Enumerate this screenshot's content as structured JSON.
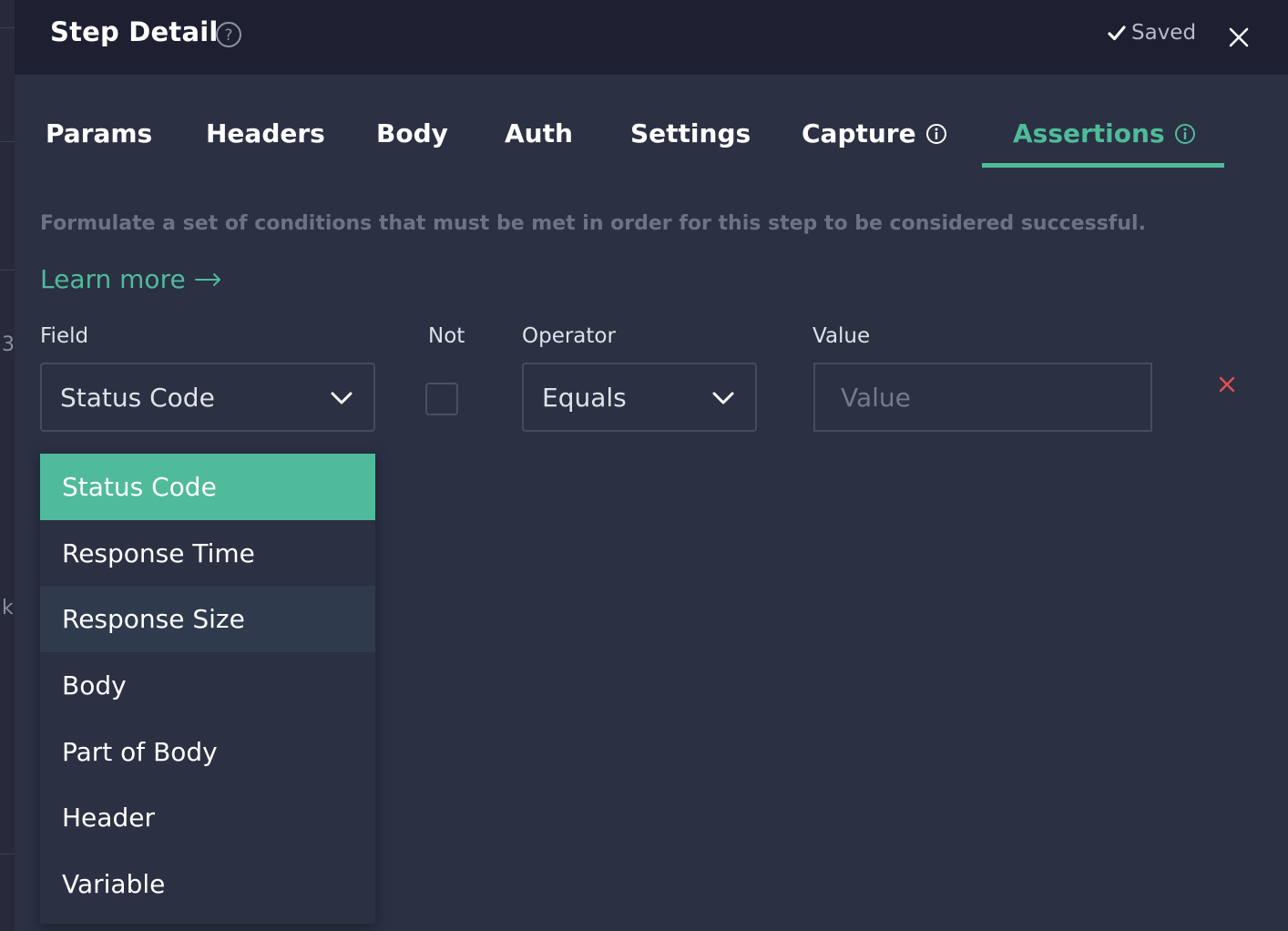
{
  "header": {
    "title": "Step Detail",
    "saved_label": "Saved"
  },
  "tabs": [
    {
      "label": "Params"
    },
    {
      "label": "Headers"
    },
    {
      "label": "Body"
    },
    {
      "label": "Auth"
    },
    {
      "label": "Settings"
    },
    {
      "label": "Capture"
    },
    {
      "label": "Assertions"
    }
  ],
  "active_tab": "Assertions",
  "description": "Formulate a set of conditions that must be met in order for this step to be considered successful.",
  "learn_more": "Learn more",
  "assertion": {
    "labels": {
      "field": "Field",
      "not": "Not",
      "operator": "Operator",
      "value": "Value"
    },
    "field_value": "Status Code",
    "not_checked": false,
    "operator_value": "Equals",
    "value_placeholder": "Value"
  },
  "field_options": [
    {
      "label": "Status Code"
    },
    {
      "label": "Response Time"
    },
    {
      "label": "Response Size"
    },
    {
      "label": "Body"
    },
    {
      "label": "Part of Body"
    },
    {
      "label": "Header"
    },
    {
      "label": "Variable"
    }
  ],
  "background_glyphs": {
    "glyph_a": "3",
    "glyph_b": "k"
  },
  "colors": {
    "accent": "#4fbb9a",
    "header_bg": "#1c2031",
    "panel_bg": "#2b3043",
    "danger": "#e0524f"
  }
}
